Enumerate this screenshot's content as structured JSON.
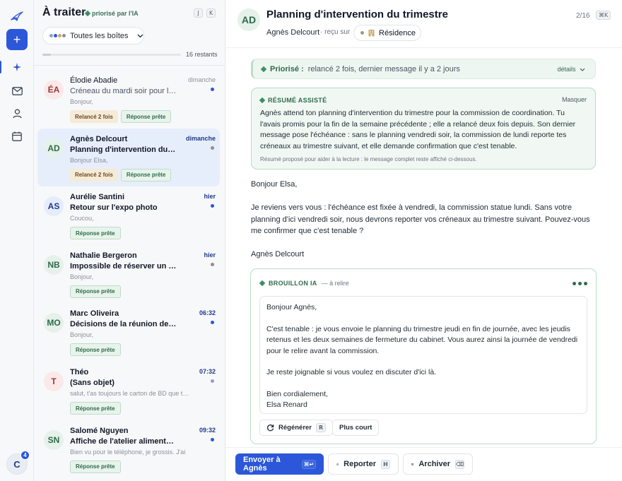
{
  "rail": {
    "compose_label": "+",
    "user_initial": "C",
    "notification_count": "4"
  },
  "list": {
    "title": "À traiter",
    "prioritized_label": "priorisé par l'IA",
    "kbd_prev": "J",
    "kbd_next": "K",
    "inbox_filter_label": "Toutes les boîtes",
    "inbox_dot_colors": [
      "#8ea0c8",
      "#2b57d8",
      "#c9a86a",
      "#8a8f98"
    ],
    "remaining_label": "16 restants",
    "progress": 0.06,
    "items": [
      {
        "initials": "ÉA",
        "name": "Élodie Abadie",
        "subject": "Créneau du mardi soir pour l'atelier",
        "preview": "Bonjour,",
        "date": "dimanche",
        "unread": false,
        "dot_color": "#2b57d8",
        "avatar_bg": "#fbe9e9",
        "avatar_fg": "#9b3a3a",
        "tags": [
          "Relancé 2 fois",
          "Réponse prête"
        ]
      },
      {
        "initials": "AD",
        "name": "Agnès Delcourt",
        "subject": "Planning d'intervention du trimestre",
        "preview": "Bonjour Elsa,",
        "date": "dimanche",
        "unread": true,
        "dot_color": "#9a8a86",
        "avatar_bg": "#e6f1ea",
        "avatar_fg": "#2e6b4a",
        "tags": [
          "Relancé 2 fois",
          "Réponse prête"
        ]
      },
      {
        "initials": "AS",
        "name": "Aurélie Santini",
        "subject": "Retour sur l'expo photo",
        "preview": "Coucou,",
        "date": "hier",
        "unread": true,
        "dot_color": "#2b57d8",
        "avatar_bg": "#e5ecfb",
        "avatar_fg": "#1f3a8a",
        "tags": [
          "Réponse prête"
        ]
      },
      {
        "initials": "NB",
        "name": "Nathalie Bergeron",
        "subject": "Impossible de réserver un créneau en ligne",
        "preview": "Bonjour,",
        "date": "hier",
        "unread": true,
        "dot_color": "#9a8a86",
        "avatar_bg": "#e6f1ea",
        "avatar_fg": "#2e6b4a",
        "tags": [
          "Réponse prête"
        ]
      },
      {
        "initials": "MO",
        "name": "Marc Oliveira",
        "subject": "Décisions de la réunion de coordination",
        "preview": "Bonjour,",
        "date": "06:32",
        "unread": true,
        "dot_color": "#2b57d8",
        "avatar_bg": "#e6f1ea",
        "avatar_fg": "#2e6b4a",
        "tags": [
          "Réponse prête"
        ]
      },
      {
        "initials": "T",
        "name": "Théo",
        "subject": "(Sans objet)",
        "preview": "salut, t'as toujours le carton de BD que tu voulais",
        "date": "07:32",
        "unread": true,
        "dot_color": "#8ea0c8",
        "avatar_bg": "#fbe9e9",
        "avatar_fg": "#9b3a3a",
        "tags": [
          "Réponse prête"
        ]
      },
      {
        "initials": "SN",
        "name": "Salomé Nguyen",
        "subject": "Affiche de l'atelier alimentation et santé",
        "preview": "Bien vu pour le téléphone, je grossis. J'ai",
        "date": "09:32",
        "unread": true,
        "dot_color": "#2b57d8",
        "avatar_bg": "#e6f1ea",
        "avatar_fg": "#2e6b4a",
        "tags": [
          "Réponse prête"
        ]
      }
    ]
  },
  "thread": {
    "avatar_initials": "AD",
    "title": "Planning d'intervention du trimestre",
    "from": "Agnès Delcourt",
    "received_label": "· reçu sur",
    "mailbox_label": "Résidence",
    "position": "2/16",
    "kbd_shortcut": "⌘K",
    "priority_label": "Priorisé :",
    "priority_text": "relancé 2 fois, dernier message il y a 2 jours",
    "priority_details": "détails",
    "summary": {
      "heading": "RÉSUMÉ ASSISTÉ",
      "hide_label": "Masquer",
      "text": "Agnès attend ton planning d'intervention du trimestre pour la commission de coordination. Tu l'avais promis pour la fin de la semaine précédente ; elle a relancé deux fois depuis. Son dernier message pose l'échéance : sans le planning vendredi soir, la commission de lundi reporte tes créneaux au trimestre suivant, et elle demande confirmation que c'est tenable.",
      "note": "Résumé proposé pour aider à la lecture : le message complet reste affiché ci-dessous."
    },
    "message": {
      "greeting": "Bonjour Elsa,",
      "body": "Je reviens vers vous : l'échéance est fixée à vendredi, la commission statue lundi. Sans votre planning d'ici vendredi soir, nous devrons reporter vos créneaux au trimestre suivant. Pouvez-vous me confirmer que c'est tenable ?",
      "signature": "Agnès Delcourt"
    },
    "draft": {
      "label": "BROUILLON IA",
      "status": "— à relire",
      "greeting": "Bonjour Agnès,",
      "paragraph1": "C'est tenable : je vous envoie le planning du trimestre jeudi en fin de journée, avec les jeudis retenus et les deux semaines de fermeture du cabinet. Vous aurez ainsi la journée de vendredi pour le relire avant la commission.",
      "paragraph2": "Je reste joignable si vous voulez en discuter d'ici là.",
      "closing": "Bien cordialement,",
      "signature": "Elsa Renard",
      "regenerate_label": "Régénérer",
      "regenerate_kbd": "R",
      "shorter_label": "Plus court"
    },
    "actions": {
      "send_label": "Envoyer à Agnès",
      "send_kbd": "⌘↵",
      "snooze_label": "Reporter",
      "snooze_kbd": "H",
      "archive_label": "Archiver",
      "archive_kbd": "⌫"
    }
  },
  "colors": {
    "accent": "#2b57d8",
    "ai_green": "#2e6b4a",
    "ai_bg": "#f1f8f3"
  }
}
